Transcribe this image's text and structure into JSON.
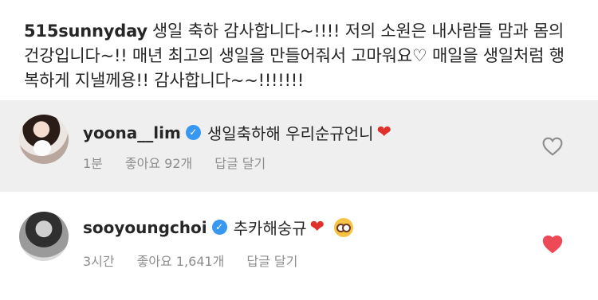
{
  "post": {
    "caption_user": "515sunnyday",
    "caption_text": "생일 축하 감사합니다~!!!! 저의 소원은 내사람들 맘과 몸의 건강입니다~!! 매년 최고의 생일을 만들어줘서 고마워요♡ 매일을 생일처럼 행복하게 지낼께용!! 감사합니다~~!!!!!!!"
  },
  "comments": [
    {
      "username": "yoona__lim",
      "verified": true,
      "text": "생일축하해 우리순규언니",
      "emoji": "❤",
      "time": "1분",
      "likes": "좋아요 92개",
      "reply": "답글 달기",
      "liked": false
    },
    {
      "username": "sooyoungchoi",
      "verified": true,
      "text": "추카해숭규",
      "emoji": "❤",
      "emoji2": "nerd-face",
      "time": "3시간",
      "likes": "좋아요 1,641개",
      "reply": "답글 달기",
      "liked": true
    }
  ],
  "icons": {
    "verified": "verified-badge-icon",
    "like": "heart-icon"
  },
  "colors": {
    "verified": "#3897f0",
    "liked": "#ed4956",
    "meta": "#8e8e8e",
    "highlight_bg": "#efefef"
  }
}
